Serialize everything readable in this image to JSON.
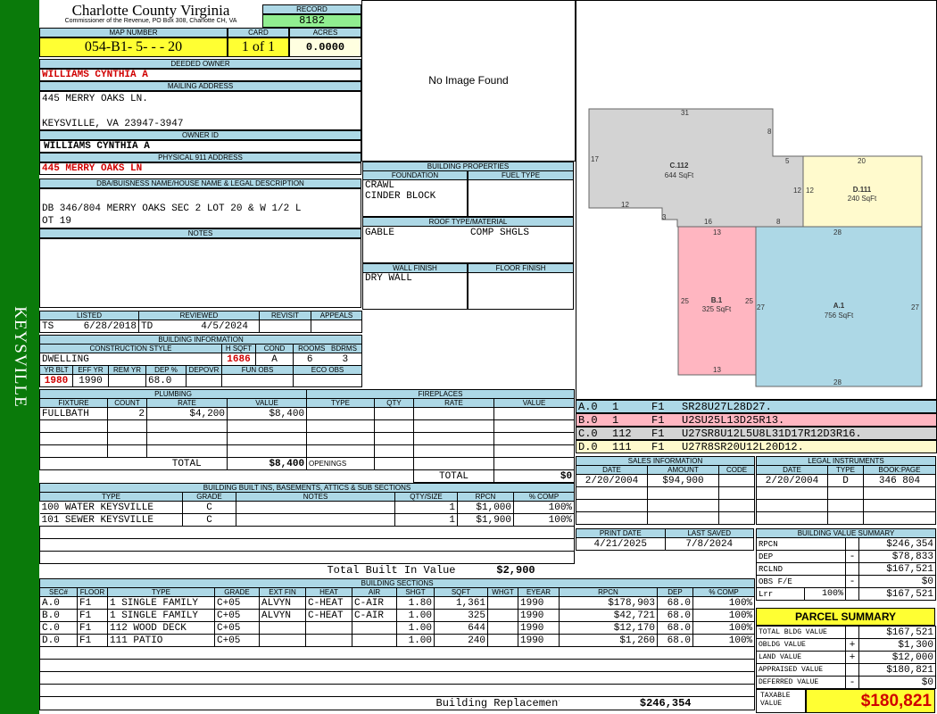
{
  "sidebar": {
    "label": "KEYSVILLE"
  },
  "header": {
    "county": "Charlotte County Virginia",
    "commissioner": "Commissioner of the Revenue, PO Box 308, Charlotte CH, VA",
    "record_label": "RECORD",
    "record": "8182",
    "map_number_label": "MAP NUMBER",
    "map_number": "054-B1- 5-  -  - 20",
    "card_label": "CARD",
    "card": "1 of 1",
    "acres_label": "ACRES",
    "acres": "0.0000"
  },
  "owner": {
    "deeded_owner_label": "DEEDED OWNER",
    "deeded_owner": "WILLIAMS CYNTHIA A",
    "mailing_label": "MAILING ADDRESS",
    "mailing_line1": "445 MERRY OAKS LN.",
    "mailing_line2": "KEYSVILLE, VA 23947-3947",
    "owner_id_label": "OWNER ID",
    "owner_id": "WILLIAMS CYNTHIA A",
    "physical_label": "PHYSICAL 911 ADDRESS",
    "physical": "445 MERRY OAKS  LN",
    "legal_label": "DBA/BUISNESS NAME/HOUSE NAME & LEGAL DESCRIPTION",
    "legal_line1": "DB 346/804 MERRY OAKS SEC 2 LOT 20  & W 1/2 L",
    "legal_line2": "OT  19",
    "notes_label": "NOTES"
  },
  "image": {
    "placeholder": "No Image Found"
  },
  "building_properties": {
    "title": "BUILDING PROPERTIES",
    "foundation_label": "FOUNDATION",
    "fuel_label": "FUEL TYPE",
    "foundation1": "CRAWL",
    "foundation2": "CINDER BLOCK",
    "roof_label": "ROOF TYPE/MATERIAL",
    "roof_type": "GABLE",
    "roof_material": "COMP SHGLS",
    "wall_label": "WALL FINISH",
    "floor_label": "FLOOR FINISH",
    "wall": "DRY WALL"
  },
  "review": {
    "listed_label": "LISTED",
    "reviewed_label": "REVIEWED",
    "revisit_label": "REVISIT",
    "appeals_label": "APPEALS",
    "listed_by": "TS",
    "listed_date": "6/28/2018",
    "reviewed_by": "TD",
    "reviewed_date": "4/5/2024"
  },
  "building_info": {
    "title": "BUILDING INFORMATION",
    "style_label": "CONSTRUCTION STYLE",
    "hsqft_label": "H SQFT",
    "cond_label": "COND",
    "rooms_label": "ROOMS",
    "bdrms_label": "BDRMS",
    "style": "DWELLING",
    "hsqft": "1686",
    "cond": "A",
    "rooms": "6",
    "bdrms": "3",
    "yrblt_label": "YR BLT",
    "effyr_label": "EFF YR",
    "remyr_label": "REM YR",
    "dep_label": "DEP %",
    "depovr_label": "DEPOVR",
    "funobs_label": "FUN OBS",
    "ecoobs_label": "ECO OBS",
    "yrblt": "1980",
    "effyr": "1990",
    "dep": "68.0"
  },
  "plumbing": {
    "title": "PLUMBING",
    "headers": [
      "FIXTURE",
      "COUNT",
      "RATE",
      "VALUE"
    ],
    "rows": [
      [
        "FULLBATH",
        "2",
        "$4,200",
        "$8,400"
      ]
    ],
    "total_label": "TOTAL",
    "total": "$8,400"
  },
  "fireplaces": {
    "title": "FIREPLACES",
    "headers": [
      "TYPE",
      "QTY",
      "RATE",
      "VALUE"
    ],
    "openings_label": "OPENINGS",
    "total_label": "TOTAL",
    "total": "$0"
  },
  "builtins": {
    "title": "BUILDING BUILT INS, BASEMENTS, ATTICS & SUB SECTIONS",
    "headers": [
      "TYPE",
      "GRADE",
      "NOTES",
      "QTY/SIZE",
      "RPCN",
      "% COMP"
    ],
    "rows": [
      [
        "100 WATER KEYSVILLE",
        "C",
        "",
        "1",
        "$1,000",
        "100%"
      ],
      [
        "101 SEWER KEYSVILLE",
        "C",
        "",
        "1",
        "$1,900",
        "100%"
      ]
    ],
    "total_label": "Total Built In Value",
    "total": "$2,900"
  },
  "sketch": {
    "sections": [
      {
        "label": "C.112",
        "area": "644 SqFt",
        "color": "#d3d3d3"
      },
      {
        "label": "D.111",
        "area": "240 SqFt",
        "color": "#fffacd"
      },
      {
        "label": "B.1",
        "area": "325 SqFt",
        "color": "#ffb6c1"
      },
      {
        "label": "A.1",
        "area": "756 SqFt",
        "color": "#add8e6"
      }
    ],
    "dims": [
      "31",
      "8",
      "5",
      "20",
      "17",
      "12",
      "12",
      "12",
      "3",
      "16",
      "8",
      "28",
      "13",
      "25",
      "25",
      "27",
      "27",
      "13",
      "28"
    ],
    "codes": [
      {
        "sec": "A.0",
        "n": "1",
        "fl": "F1",
        "code": "SR28U27L28D27.",
        "color": "#add8e6"
      },
      {
        "sec": "B.0",
        "n": "1",
        "fl": "F1",
        "code": "U2SU25L13D25R13.",
        "color": "#ffb6c1"
      },
      {
        "sec": "C.0",
        "n": "112",
        "fl": "F1",
        "code": "U27SR8U12L5U8L31D17R12D3R16.",
        "color": "#d3d3d3"
      },
      {
        "sec": "D.0",
        "n": "111",
        "fl": "F1",
        "code": "U27R8SR20U12L20D12.",
        "color": "#fffacd"
      }
    ]
  },
  "sales": {
    "title": "SALES INFORMATION",
    "headers": [
      "DATE",
      "AMOUNT",
      "CODE"
    ],
    "rows": [
      [
        "2/20/2004",
        "$94,900",
        ""
      ]
    ]
  },
  "legal": {
    "title": "LEGAL INSTRUMENTS",
    "headers": [
      "DATE",
      "TYPE",
      "BOOK:PAGE"
    ],
    "rows": [
      [
        "2/20/2004",
        "D",
        "346 804"
      ]
    ]
  },
  "dates": {
    "print_label": "PRINT DATE",
    "print": "4/21/2025",
    "saved_label": "LAST SAVED",
    "saved": "7/8/2024"
  },
  "value_summary": {
    "title": "BUILDING VALUE SUMMARY",
    "rows": [
      {
        "label": "RPCN",
        "sign": "",
        "value": "$246,354"
      },
      {
        "label": "DEP",
        "sign": "-",
        "value": "$78,833"
      },
      {
        "label": "RCLND",
        "sign": "",
        "value": "$167,521"
      },
      {
        "label": "OBS F/E",
        "sign": "-",
        "value": "$0"
      },
      {
        "label": "Lrr",
        "pct": "100%",
        "sign": "",
        "value": "$167,521"
      }
    ]
  },
  "parcel_summary": {
    "title": "PARCEL SUMMARY",
    "rows": [
      {
        "label": "TOTAL BLDG VALUE",
        "sign": "",
        "value": "$167,521"
      },
      {
        "label": "OBLDG VALUE",
        "sign": "+",
        "value": "$1,300"
      },
      {
        "label": "LAND VALUE",
        "sign": "+",
        "value": "$12,000"
      },
      {
        "label": "APPRAISED VALUE",
        "sign": "",
        "value": "$180,821"
      },
      {
        "label": "DEFERRED VALUE",
        "sign": "-",
        "value": "$0"
      }
    ],
    "taxable_label1": "TAXABLE",
    "taxable_label2": "VALUE",
    "taxable": "$180,821"
  },
  "sections": {
    "title": "BUILDING SECTIONS",
    "headers": [
      "SEC#",
      "FLOOR",
      "TYPE",
      "GRADE",
      "EXT FIN",
      "HEAT",
      "AIR",
      "SHGT",
      "SQFT",
      "WHGT",
      "EYEAR",
      "RPCN",
      "DEP",
      "% COMP"
    ],
    "rows": [
      [
        "A.0",
        "F1",
        "1 SINGLE FAMILY",
        "C+05",
        "ALVYN",
        "C-HEAT",
        "C-AIR",
        "1.80",
        "1,361",
        "",
        "1990",
        "$178,903",
        "68.0",
        "100%"
      ],
      [
        "B.0",
        "F1",
        "1 SINGLE FAMILY",
        "C+05",
        "ALVYN",
        "C-HEAT",
        "C-AIR",
        "1.00",
        "325",
        "",
        "1990",
        "$42,721",
        "68.0",
        "100%"
      ],
      [
        "C.0",
        "F1",
        "112 WOOD DECK",
        "C+05",
        "",
        "",
        "",
        "1.00",
        "644",
        "",
        "1990",
        "$12,170",
        "68.0",
        "100%"
      ],
      [
        "D.0",
        "F1",
        "111 PATIO",
        "C+05",
        "",
        "",
        "",
        "1.00",
        "240",
        "",
        "1990",
        "$1,260",
        "68.0",
        "100%"
      ]
    ],
    "total_label": "Building Replacement Cost New",
    "total": "$246,354"
  }
}
